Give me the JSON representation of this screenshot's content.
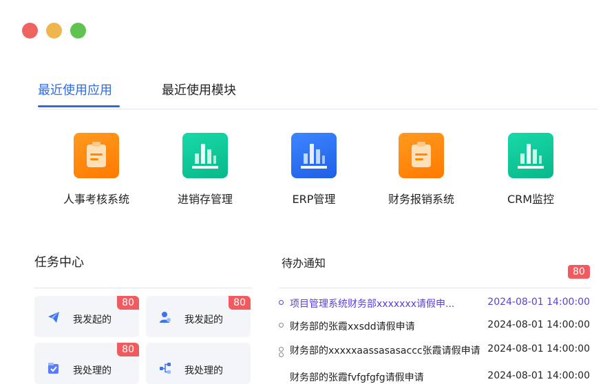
{
  "window": {
    "controls": [
      {
        "name": "close",
        "color": "#ee6461"
      },
      {
        "name": "minimize",
        "color": "#eeb64d"
      },
      {
        "name": "maximize",
        "color": "#5fc352"
      }
    ]
  },
  "tabs": [
    {
      "label": "最近使用应用",
      "active": true
    },
    {
      "label": "最近使用模块",
      "active": false
    }
  ],
  "apps": [
    {
      "label": "人事考核系统",
      "icon": "clipboard-icon",
      "color": "#ff8a00"
    },
    {
      "label": "进销存管理",
      "icon": "bar-chart-icon",
      "color": "#10c99a"
    },
    {
      "label": "ERP管理",
      "icon": "bar-chart-icon",
      "color": "#2f6bf0"
    },
    {
      "label": "财务报销系统",
      "icon": "clipboard-icon",
      "color": "#ff8a00"
    },
    {
      "label": "CRM监控",
      "icon": "bar-chart-icon",
      "color": "#10c99a"
    }
  ],
  "task_center": {
    "title": "任务中心",
    "cards": [
      {
        "label": "我发起的",
        "badge": "80",
        "icon": "paper-plane-icon"
      },
      {
        "label": "我发起的",
        "badge": "80",
        "icon": "user-icon"
      },
      {
        "label": "我处理的",
        "badge": "80",
        "icon": "checkbox-icon"
      },
      {
        "label": "我处理的",
        "badge": "",
        "icon": "share-icon"
      }
    ]
  },
  "notices": {
    "title": "待办通知",
    "badge": "80",
    "items": [
      {
        "text": "项目管理系统财务部xxxxxxx请假申...",
        "time": "2024-08-01 14:00:00",
        "highlight": true
      },
      {
        "text": "财务部的张霞xxsdd请假申请",
        "time": "2024-08-01 14:00:00",
        "highlight": false
      },
      {
        "text": "财务部的xxxxxaassasasaccc张霞请假申请",
        "time": "2024-08-01 14:00:00",
        "highlight": false
      },
      {
        "text": "财务部的张霞fvfgfgfg请假申请",
        "time": "2024-08-01 14:00:00",
        "highlight": false
      }
    ]
  },
  "colors": {
    "accent": "#2f6bde",
    "highlight": "#5b3fd6",
    "badge": "#f15b60"
  }
}
